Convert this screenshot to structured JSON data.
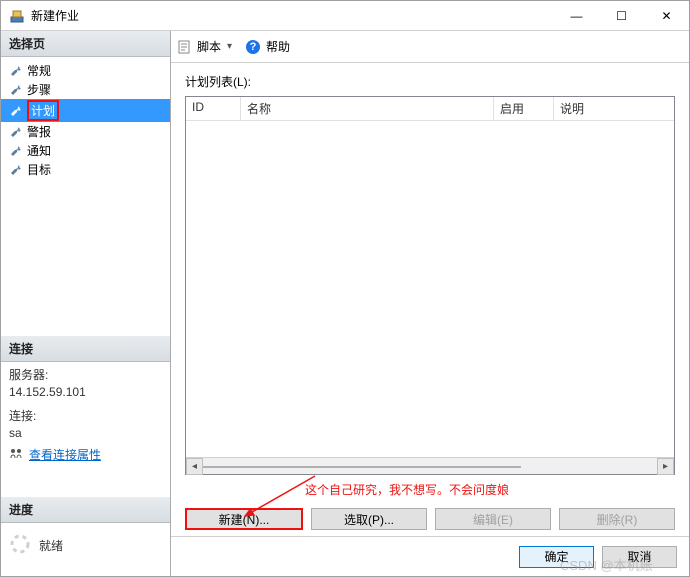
{
  "window": {
    "title": "新建作业",
    "minimize": "—",
    "maximize": "☐",
    "close": "✕"
  },
  "sidebar": {
    "header": "选择页",
    "items": [
      {
        "label": "常规"
      },
      {
        "label": "步骤"
      },
      {
        "label": "计划"
      },
      {
        "label": "警报"
      },
      {
        "label": "通知"
      },
      {
        "label": "目标"
      }
    ],
    "connection": {
      "header": "连接",
      "server_label": "服务器:",
      "server_value": "14.152.59.101",
      "conn_label": "连接:",
      "conn_value": "sa",
      "view_props": "查看连接属性"
    },
    "progress": {
      "header": "进度",
      "status": "就绪"
    }
  },
  "toolbar": {
    "script": "脚本",
    "help": "帮助"
  },
  "content": {
    "list_label": "计划列表(L):",
    "columns": {
      "id": "ID",
      "name": "名称",
      "enabled": "启用",
      "desc": "说明"
    },
    "annotation": "这个自己研究，我不想写。不会问度娘",
    "buttons": {
      "new": "新建(N)...",
      "pick": "选取(P)...",
      "edit": "编辑(E)",
      "delete": "删除(R)"
    }
  },
  "footer": {
    "ok": "确定",
    "cancel": "取消"
  },
  "watermark": "CSDN @本机账"
}
